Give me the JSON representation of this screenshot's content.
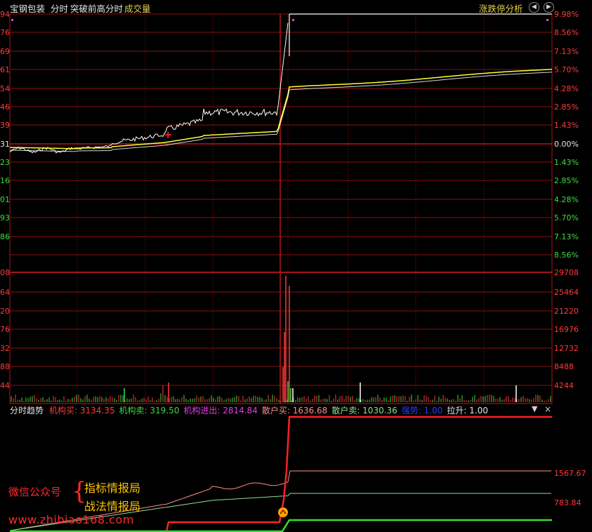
{
  "header": {
    "stock_name": "宝钢包装",
    "view_mode": "分时",
    "indicator_name": "突破前高分时",
    "volume_label": "成交量",
    "zhangdie_link": "涨跌停分析"
  },
  "price_axis": {
    "left_labels": [
      "94",
      "76",
      "69",
      "61",
      "54",
      "46",
      "39",
      "31",
      "23",
      "16",
      "01",
      "93",
      "86"
    ],
    "right_labels": [
      "9.98%",
      "8.56%",
      "7.13%",
      "5.70%",
      "4.28%",
      "2.85%",
      "1.43%",
      "0.00%",
      "1.43%",
      "2.85%",
      "4.28%",
      "5.70%",
      "7.13%",
      "8.56%"
    ]
  },
  "volume_axis": {
    "left_labels": [
      "08",
      "64",
      "20",
      "76",
      "32",
      "88",
      "44"
    ],
    "right_labels": [
      "29708",
      "25464",
      "21220",
      "16976",
      "12732",
      "8488",
      "4244"
    ]
  },
  "indicator_panel": {
    "name": "分时趋势",
    "items": [
      {
        "label": "机构买:",
        "value": "3134.35",
        "color": "#ff3b3b"
      },
      {
        "label": "机构卖:",
        "value": "319.50",
        "color": "#3ddc3d"
      },
      {
        "label": "机构进出:",
        "value": "2814.84",
        "color": "#e040e0"
      },
      {
        "label": "散户买:",
        "value": "1636.68",
        "color": "#ff8c8c"
      },
      {
        "label": "散户卖:",
        "value": "1030.36",
        "color": "#8ee08e"
      },
      {
        "label": "强势:",
        "value": "1.00",
        "color": "#2a3cff"
      },
      {
        "label": "拉升:",
        "value": "1.00",
        "color": "#e6e6e6"
      }
    ],
    "axis_labels": [
      "1567.67",
      "783.84"
    ]
  },
  "watermark": {
    "gzh": "微信公众号",
    "brace": "{",
    "zbqb": "指标情报局",
    "zfqb": "战法情报局",
    "url": "www.zhibiao168.com"
  },
  "colors": {
    "grid": "#8b1010",
    "price_line": "#ffffff",
    "avg_line": "#ffff33",
    "up": "#ff3b3b",
    "down": "#3ddc3d",
    "label_up": "#ff3b3b",
    "label_down": "#3ddc3d",
    "gold": "#e5d24a"
  }
}
